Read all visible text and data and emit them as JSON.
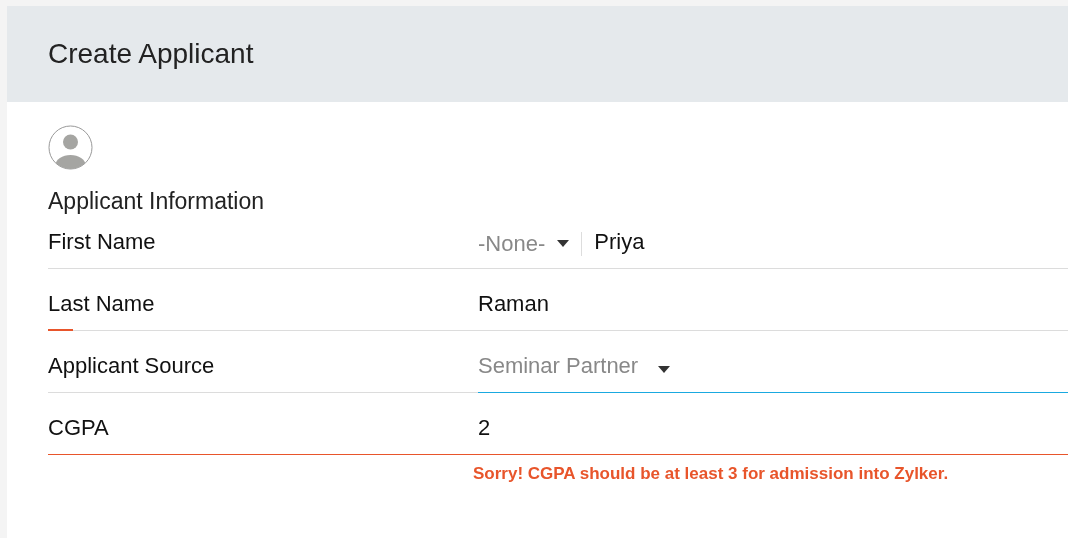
{
  "header": {
    "title": "Create Applicant"
  },
  "section": {
    "title": "Applicant Information"
  },
  "fields": [
    {
      "kind": "name",
      "label": "First Name",
      "salutation": "-None-",
      "value": "Priya",
      "required": false,
      "focused": false,
      "error": false
    },
    {
      "kind": "text",
      "label": "Last Name",
      "value": "Raman",
      "required": true,
      "focused": false,
      "error": false
    },
    {
      "kind": "select",
      "label": "Applicant Source",
      "value": "Seminar Partner",
      "required": false,
      "focused": true,
      "error": false
    },
    {
      "kind": "text",
      "label": "CGPA",
      "value": "2",
      "required": false,
      "focused": false,
      "error": true,
      "message": "Sorry! CGPA should be at least 3 for admission into Zylker."
    }
  ]
}
